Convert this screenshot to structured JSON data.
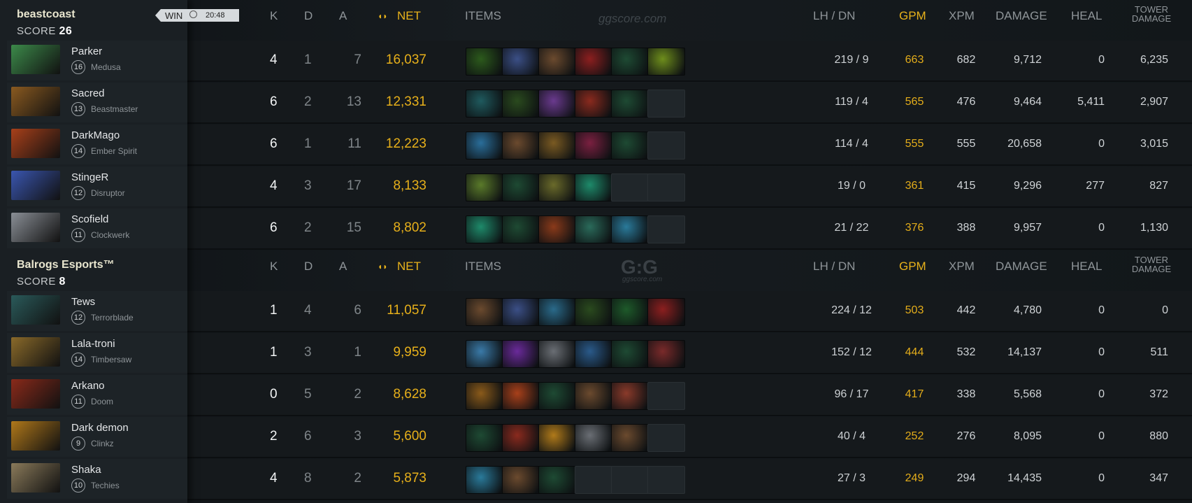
{
  "teams": [
    {
      "name": "beastcoast",
      "score_label": "SCORE",
      "score": "26",
      "result": "WIN",
      "duration": "20:48",
      "header": {
        "k": "K",
        "d": "D",
        "a": "A",
        "net": "NET",
        "items": "ITEMS",
        "lh_dn": "LH  /  DN",
        "gpm": "GPM",
        "xpm": "XPM",
        "damage": "DAMAGE",
        "heal": "HEAL",
        "tower1": "TOWER",
        "tower2": "DAMAGE"
      },
      "watermark": "ggscore.com",
      "players": [
        {
          "name": "Parker",
          "level": "16",
          "hero": "Medusa",
          "k": "4",
          "d": "1",
          "a": "7",
          "net": "16,037",
          "lh_dn": "219  /  9",
          "gpm": "663",
          "xpm": "682",
          "damage": "9,712",
          "heal": "0",
          "tower": "6,235",
          "portrait": "#3c8a4a",
          "items": [
            "#2c5a1c",
            "#3b4f86",
            "#6b4a2e",
            "#8c1f1f",
            "#1e4a33",
            "#6e8e1c"
          ]
        },
        {
          "name": "Sacred",
          "level": "13",
          "hero": "Beastmaster",
          "k": "6",
          "d": "2",
          "a": "13",
          "net": "12,331",
          "lh_dn": "119  /  4",
          "gpm": "565",
          "xpm": "476",
          "damage": "9,464",
          "heal": "5,411",
          "tower": "2,907",
          "portrait": "#8a5a20",
          "items": [
            "#1f5a5e",
            "#2a4a1e",
            "#6a3a8e",
            "#8a2a1e",
            "#1e4a33",
            ""
          ]
        },
        {
          "name": "DarkMago",
          "level": "14",
          "hero": "Ember Spirit",
          "k": "6",
          "d": "1",
          "a": "11",
          "net": "12,223",
          "lh_dn": "114  /  4",
          "gpm": "555",
          "xpm": "555",
          "damage": "20,658",
          "heal": "0",
          "tower": "3,015",
          "portrait": "#a8401a",
          "items": [
            "#2a6e9a",
            "#6b4a2e",
            "#7a5a22",
            "#7a2040",
            "#1e4a33",
            ""
          ]
        },
        {
          "name": "StingeR",
          "level": "12",
          "hero": "Disruptor",
          "k": "4",
          "d": "3",
          "a": "17",
          "net": "8,133",
          "lh_dn": "19  /  0",
          "gpm": "361",
          "xpm": "415",
          "damage": "9,296",
          "heal": "277",
          "tower": "827",
          "portrait": "#3a56b0",
          "items": [
            "#5a7a2a",
            "#1e4a33",
            "#6a6a2a",
            "#1e8a6a",
            "",
            ""
          ]
        },
        {
          "name": "Scofield",
          "level": "11",
          "hero": "Clockwerk",
          "k": "6",
          "d": "2",
          "a": "15",
          "net": "8,802",
          "lh_dn": "21  /  22",
          "gpm": "376",
          "xpm": "388",
          "damage": "9,957",
          "heal": "0",
          "tower": "1,130",
          "portrait": "#8a8f96",
          "items": [
            "#1e8a6a",
            "#1e4a33",
            "#8a3a1a",
            "#2a6a5a",
            "#2a7a9a",
            ""
          ]
        }
      ]
    },
    {
      "name": "Balrogs  Esports™",
      "score_label": "SCORE",
      "score": "8",
      "header": {
        "k": "K",
        "d": "D",
        "a": "A",
        "net": "NET",
        "items": "ITEMS",
        "lh_dn": "LH  /  DN",
        "gpm": "GPM",
        "xpm": "XPM",
        "damage": "DAMAGE",
        "heal": "HEAL",
        "tower1": "TOWER",
        "tower2": "DAMAGE"
      },
      "watermark": "G:G",
      "watermark_sub": "ggscore.com",
      "players": [
        {
          "name": "Tews",
          "level": "12",
          "hero": "Terrorblade",
          "k": "1",
          "d": "4",
          "a": "6",
          "net": "11,057",
          "lh_dn": "224  /  12",
          "gpm": "503",
          "xpm": "442",
          "damage": "4,780",
          "heal": "0",
          "tower": "0",
          "portrait": "#2a5a5a",
          "items": [
            "#6b4a2e",
            "#3b4f86",
            "#2a6a8a",
            "#2a4a1e",
            "#1e5a2a",
            "#8c1f1f"
          ]
        },
        {
          "name": "Lala-troni",
          "level": "14",
          "hero": "Timbersaw",
          "k": "1",
          "d": "3",
          "a": "1",
          "net": "9,959",
          "lh_dn": "152  /  12",
          "gpm": "444",
          "xpm": "532",
          "damage": "14,137",
          "heal": "0",
          "tower": "511",
          "portrait": "#8a6a2a",
          "items": [
            "#3a7aa8",
            "#6a2a9a",
            "#6a6e74",
            "#2a5a8a",
            "#1e4a33",
            "#7a2a2a"
          ]
        },
        {
          "name": "Arkano",
          "level": "11",
          "hero": "Doom",
          "k": "0",
          "d": "5",
          "a": "2",
          "net": "8,628",
          "lh_dn": "96  /  17",
          "gpm": "417",
          "xpm": "338",
          "damage": "5,568",
          "heal": "0",
          "tower": "372",
          "portrait": "#8a2a1a",
          "items": [
            "#8a5a1a",
            "#a8401a",
            "#1e4a33",
            "#6b4a2e",
            "#8a3a2a",
            ""
          ]
        },
        {
          "name": "Dark demon",
          "level": "9",
          "hero": "Clinkz",
          "k": "2",
          "d": "6",
          "a": "3",
          "net": "5,600",
          "lh_dn": "40  /  4",
          "gpm": "252",
          "xpm": "276",
          "damage": "8,095",
          "heal": "0",
          "tower": "880",
          "portrait": "#b0781a",
          "items": [
            "#1e4a33",
            "#8a2a1e",
            "#b07a1a",
            "#6a6e74",
            "#6b4a2e",
            ""
          ]
        },
        {
          "name": "Shaka",
          "level": "10",
          "hero": "Techies",
          "k": "4",
          "d": "8",
          "a": "2",
          "net": "5,873",
          "lh_dn": "27  /  3",
          "gpm": "249",
          "xpm": "294",
          "damage": "14,435",
          "heal": "0",
          "tower": "347",
          "portrait": "#8a7a5a",
          "items": [
            "#2a7a9a",
            "#6b4a2e",
            "#1e4a33",
            "",
            "",
            ""
          ]
        }
      ]
    }
  ]
}
